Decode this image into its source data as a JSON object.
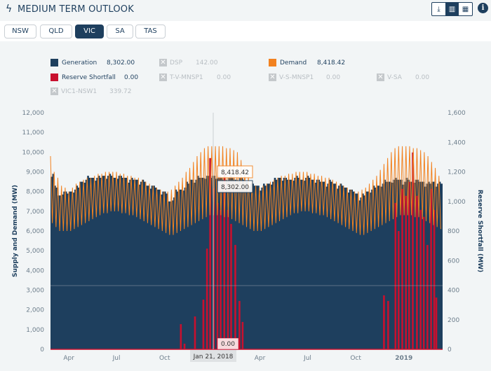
{
  "header": {
    "title": "MEDIUM TERM OUTLOOK",
    "icon": "bolt-icon",
    "tools": [
      {
        "name": "download-icon",
        "glyph": "⤓"
      },
      {
        "name": "chart-icon",
        "glyph": "▥",
        "active": true
      },
      {
        "name": "table-icon",
        "glyph": "▦"
      }
    ],
    "info": "i"
  },
  "tabs": [
    {
      "label": "NSW"
    },
    {
      "label": "QLD"
    },
    {
      "label": "VIC",
      "active": true
    },
    {
      "label": "SA"
    },
    {
      "label": "TAS"
    }
  ],
  "legend": [
    {
      "label": "Generation",
      "value": "8,302.00",
      "color": "#1e3f5e",
      "enabled": true
    },
    {
      "label": "DSP",
      "value": "142.00",
      "enabled": false
    },
    {
      "label": "Demand",
      "value": "8,418.42",
      "color": "#f28220",
      "enabled": true
    },
    {
      "label": "Reserve Shortfall",
      "value": "0.00",
      "color": "#c8102e",
      "enabled": true
    },
    {
      "label": "T-V-MNSP1",
      "value": "0.00",
      "enabled": false
    },
    {
      "label": "V-S-MNSP1",
      "value": "0.00",
      "enabled": false
    },
    {
      "label": "V-SA",
      "value": "0.00",
      "enabled": false
    },
    {
      "label": "VIC1-NSW1",
      "value": "339.72",
      "enabled": false
    }
  ],
  "chart_data": {
    "type": "area",
    "ylabel": "Supply and Demand (MW)",
    "y2label": "Reserve Shortfall (MW)",
    "ylim": [
      0,
      12000
    ],
    "y2lim": [
      0,
      1600
    ],
    "yticks": [
      "0",
      "1,000",
      "2,000",
      "3,000",
      "4,000",
      "5,000",
      "6,000",
      "7,000",
      "8,000",
      "9,000",
      "10,000",
      "11,000",
      "12,000"
    ],
    "y2ticks": [
      "0",
      "200",
      "400",
      "600",
      "800",
      "1,000",
      "1,200",
      "1,400",
      "1,600"
    ],
    "xlim": [
      "2017-03-05",
      "2019-03-24"
    ],
    "xticks": [
      {
        "label": "Apr",
        "date": "2017-04-01"
      },
      {
        "label": "Jul",
        "date": "2017-07-01"
      },
      {
        "label": "Oct",
        "date": "2017-10-01"
      },
      {
        "label": "Apr",
        "date": "2018-04-01"
      },
      {
        "label": "Jul",
        "date": "2018-07-01"
      },
      {
        "label": "Oct",
        "date": "2018-10-01"
      },
      {
        "label": "2019",
        "date": "2019-01-01",
        "bold": true
      }
    ],
    "series": [
      {
        "name": "Generation",
        "color": "#1e3f5e",
        "frequency": "weekly",
        "values": [
          8900,
          8200,
          7800,
          8000,
          7900,
          8000,
          8100,
          8200,
          8500,
          8600,
          8700,
          8700,
          8700,
          8700,
          8800,
          8800,
          8800,
          8700,
          8800,
          8700,
          8700,
          8600,
          8600,
          8600,
          8500,
          8500,
          8300,
          8300,
          8200,
          8100,
          8000,
          7900,
          7500,
          7700,
          8000,
          8100,
          8200,
          8400,
          8600,
          8600,
          8700,
          8700,
          8800,
          8700,
          8800,
          8800,
          8700,
          8600,
          8700,
          8700,
          8600,
          8700,
          8600,
          8500,
          8400,
          8300,
          8300,
          8200,
          8300,
          8400,
          8500,
          8600,
          8700,
          8700,
          8600,
          8600,
          8700,
          8700,
          8600,
          8700,
          8700,
          8600,
          8600,
          8500,
          8500,
          8400,
          8500,
          8400,
          8300,
          8300,
          8200,
          8100,
          8000,
          7900,
          7700,
          7800,
          8000,
          8100,
          8200,
          8300,
          8400,
          8500,
          8500,
          8600,
          8600,
          8600,
          8500,
          8600,
          8500,
          8600,
          8500,
          8500,
          8400,
          8400,
          8500,
          8400,
          8400
        ]
      },
      {
        "name": "Demand",
        "color": "#f28220",
        "frequency": "weekly",
        "weekly_peak": [
          9800,
          9000,
          8700,
          8300,
          8200,
          8000,
          8200,
          8400,
          8500,
          8600,
          8700,
          8700,
          8800,
          8900,
          8900,
          9000,
          9000,
          9000,
          9000,
          8900,
          8900,
          8800,
          8800,
          8700,
          8700,
          8600,
          8500,
          8400,
          8300,
          8200,
          8100,
          8000,
          8000,
          8100,
          8300,
          8500,
          8700,
          9000,
          9200,
          9500,
          9800,
          10000,
          10200,
          10300,
          10300,
          10300,
          10300,
          10300,
          10200,
          10200,
          10100,
          10000,
          9600,
          9200,
          8800,
          8500,
          8300,
          8200,
          8300,
          8400,
          8500,
          8600,
          8700,
          8800,
          8800,
          8900,
          8900,
          9000,
          9000,
          9000,
          9000,
          8900,
          8900,
          8800,
          8800,
          8700,
          8700,
          8600,
          8500,
          8400,
          8300,
          8200,
          8100,
          8000,
          8000,
          8100,
          8200,
          8400,
          8600,
          8800,
          9100,
          9400,
          9700,
          10000,
          10200,
          10300,
          10300,
          10300,
          10300,
          10200,
          10200,
          10100,
          10000,
          9800,
          9500,
          9200,
          8800
        ],
        "weekly_trough": [
          6400,
          6200,
          6000,
          6000,
          6000,
          6000,
          6100,
          6200,
          6300,
          6400,
          6500,
          6600,
          6700,
          6800,
          6900,
          6900,
          7000,
          7000,
          7000,
          6900,
          6900,
          6800,
          6800,
          6700,
          6600,
          6500,
          6400,
          6300,
          6200,
          6100,
          6000,
          5900,
          5800,
          5800,
          5900,
          6000,
          6100,
          6200,
          6300,
          6400,
          6500,
          6600,
          6700,
          6800,
          6800,
          6800,
          6800,
          6700,
          6700,
          6600,
          6500,
          6400,
          6300,
          6200,
          6100,
          6000,
          6000,
          6000,
          6100,
          6200,
          6300,
          6400,
          6500,
          6600,
          6700,
          6800,
          6900,
          6900,
          7000,
          7000,
          7000,
          6900,
          6900,
          6800,
          6800,
          6700,
          6600,
          6500,
          6400,
          6300,
          6200,
          6100,
          6000,
          5900,
          5800,
          5800,
          5900,
          6000,
          6100,
          6200,
          6300,
          6400,
          6500,
          6600,
          6700,
          6800,
          6800,
          6800,
          6800,
          6700,
          6700,
          6600,
          6500,
          6400,
          6300,
          6200,
          6100
        ]
      },
      {
        "name": "Reserve Shortfall",
        "color": "#c8102e",
        "axis": "right",
        "points": [
          [
            "2017-11-09",
            170
          ],
          [
            "2017-11-16",
            38
          ],
          [
            "2017-12-06",
            222
          ],
          [
            "2017-12-22",
            336
          ],
          [
            "2017-12-29",
            681
          ],
          [
            "2018-01-04",
            1293
          ],
          [
            "2018-01-11",
            1089
          ],
          [
            "2018-01-18",
            990
          ],
          [
            "2018-01-24",
            943
          ],
          [
            "2018-01-31",
            1198
          ],
          [
            "2018-02-07",
            943
          ],
          [
            "2018-02-13",
            848
          ],
          [
            "2018-02-21",
            706
          ],
          [
            "2018-03-01",
            327
          ],
          [
            "2018-03-07",
            185
          ],
          [
            "2018-12-02",
            365
          ],
          [
            "2018-12-10",
            327
          ],
          [
            "2018-12-24",
            990
          ],
          [
            "2018-12-30",
            800
          ],
          [
            "2019-01-06",
            1085
          ],
          [
            "2019-01-13",
            1038
          ],
          [
            "2019-01-19",
            1132
          ],
          [
            "2019-01-26",
            1331
          ],
          [
            "2019-02-03",
            1038
          ],
          [
            "2019-02-10",
            943
          ],
          [
            "2019-02-16",
            896
          ],
          [
            "2019-02-23",
            706
          ],
          [
            "2019-03-02",
            1085
          ],
          [
            "2019-03-08",
            943
          ],
          [
            "2019-03-12",
            350
          ]
        ]
      }
    ],
    "tooltip": {
      "date": "Jan 21, 2018",
      "demand": "8,418.42",
      "generation": "8,302.00",
      "shortfall": "0.00"
    },
    "grid": false,
    "legend_position": "top"
  }
}
